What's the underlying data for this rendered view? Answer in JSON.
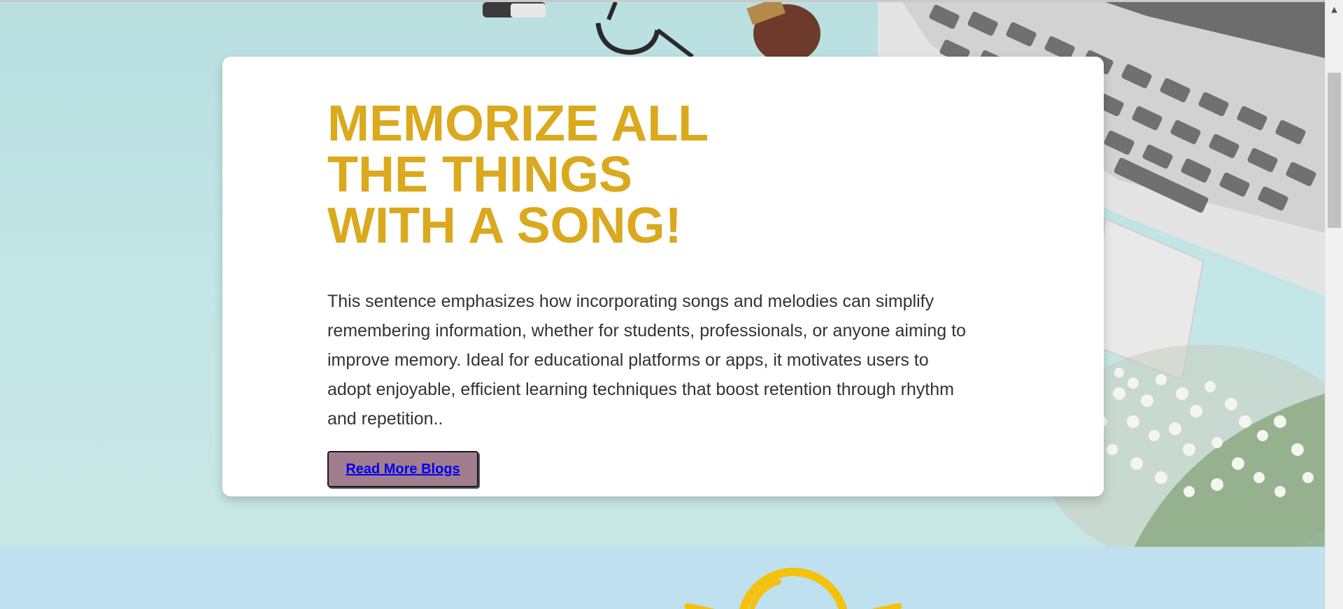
{
  "hero": {
    "headline_lines": [
      "MEMORIZE ALL",
      "THE THINGS",
      "WITH A SONG!"
    ],
    "body": "This sentence emphasizes how incorporating songs and melodies can simplify remembering information, whether for students, professionals, or anyone aiming to improve memory. Ideal for educational platforms or apps, it motivates users to adopt enjoyable, efficient learning techniques that boost retention through rhythm and repetition..",
    "button_label": "Read More Blogs"
  },
  "icons": {
    "scroll_up": "scroll-up-arrow-icon",
    "sun": "sun-icon"
  },
  "colors": {
    "headline": "#daa91e",
    "button_bg": "#a07e8f",
    "link": "#0000ee",
    "hero_bg": "#c3e6e6",
    "section_bg": "#bfe0ee",
    "sun": "#f4c20d"
  }
}
